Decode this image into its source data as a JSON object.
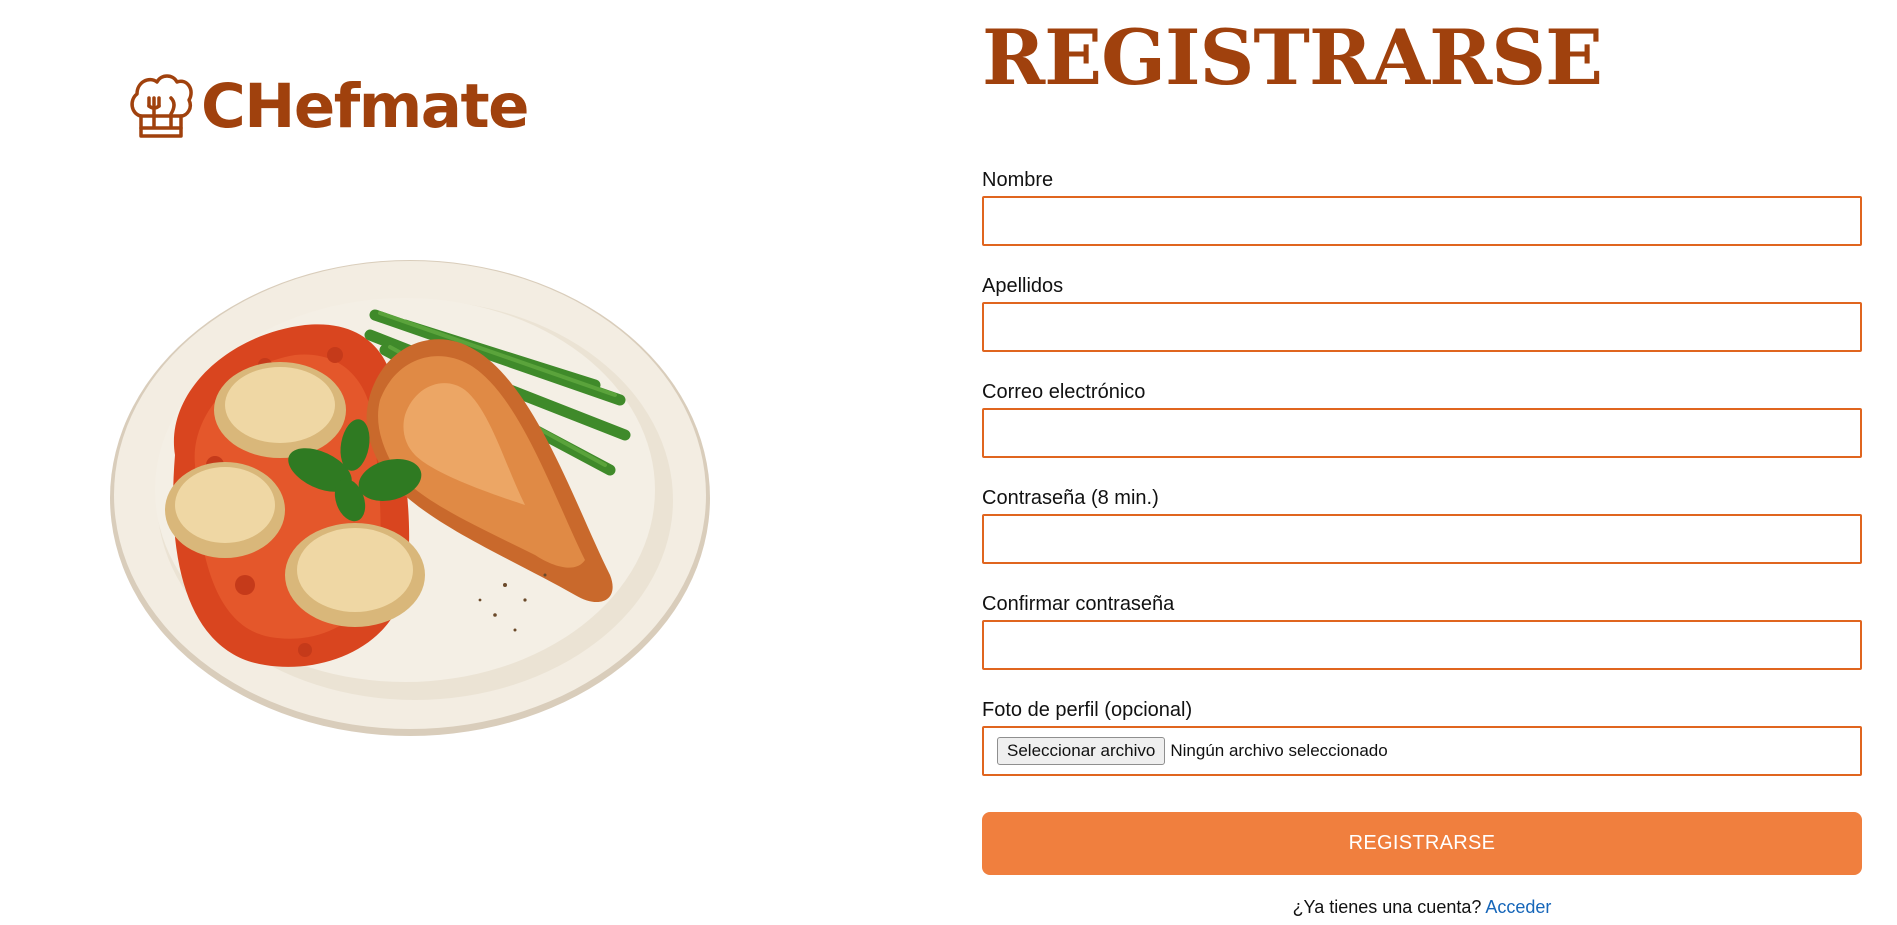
{
  "brand": {
    "name": "CHefmate",
    "icon": "chef-hat-icon",
    "color": "#a0410d"
  },
  "hero": {
    "image": "plate-of-ravioli-chicken-green-beans"
  },
  "form": {
    "title": "REGISTRARSE",
    "fields": [
      {
        "label": "Nombre",
        "value": "",
        "type": "text"
      },
      {
        "label": "Apellidos",
        "value": "",
        "type": "text"
      },
      {
        "label": "Correo electrónico",
        "value": "",
        "type": "email"
      },
      {
        "label": "Contraseña (8 min.)",
        "value": "",
        "type": "password"
      },
      {
        "label": "Confirmar contraseña",
        "value": "",
        "type": "password"
      }
    ],
    "photo": {
      "label": "Foto de perfil (opcional)",
      "button_label": "Seleccionar archivo",
      "status": "Ningún archivo seleccionado"
    },
    "submit_label": "REGISTRARSE",
    "login_prompt": "¿Ya tienes una cuenta?",
    "login_link": "Acceder"
  },
  "colors": {
    "accent": "#f07f3e",
    "border": "#e0651f",
    "title": "#a0410d",
    "link": "#1666b9"
  }
}
